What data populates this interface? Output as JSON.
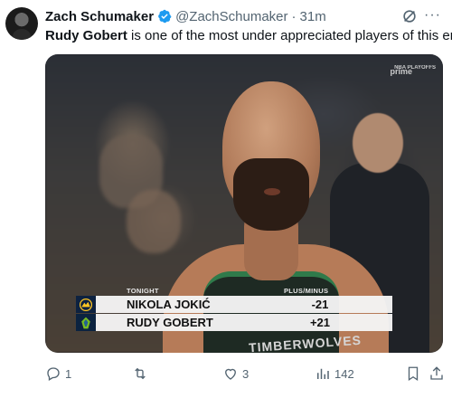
{
  "tweet": {
    "author_name": "Zach Schumaker",
    "handle": "@ZachSchumaker",
    "separator": "·",
    "time": "31m",
    "text_strong": "Rudy Gobert",
    "text_rest": " is one of the most under appreciated players of this era.",
    "verified_color": "#1d9bf0"
  },
  "media": {
    "broadcaster": "prime",
    "league_tag": "NBA PLAYOFFS",
    "overlay": {
      "left_header": "TONIGHT",
      "right_header": "PLUS/MINUS",
      "rows": [
        {
          "team": "Nuggets",
          "player": "NIKOLA JOKIĆ",
          "value": "-21"
        },
        {
          "team": "Timberwolves",
          "player": "RUDY GOBERT",
          "value": "+21"
        }
      ]
    },
    "jersey_text": "TIMBERWOLVES"
  },
  "actions": {
    "replies": "1",
    "retweets": "",
    "likes": "3",
    "views": "142"
  }
}
